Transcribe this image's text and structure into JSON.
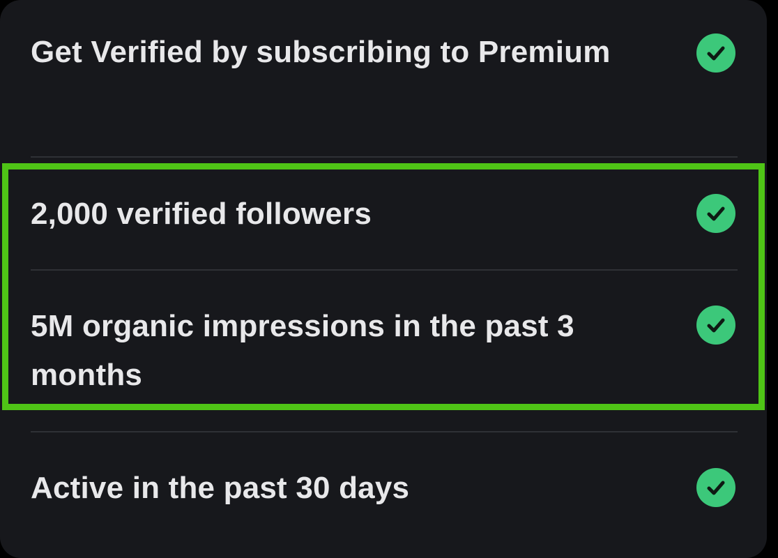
{
  "requirements": [
    {
      "label": "Get Verified by subscribing to Premium",
      "status_icon": "check-circle-icon",
      "met": true
    },
    {
      "label": "2,000 verified followers",
      "status_icon": "check-circle-icon",
      "met": true
    },
    {
      "label": "5M organic impressions in the past 3 months",
      "status_icon": "check-circle-icon",
      "met": true
    },
    {
      "label": "Active in the past 30 days",
      "status_icon": "check-circle-icon",
      "met": true
    }
  ],
  "colors": {
    "background": "#17181c",
    "text": "#e8e8ea",
    "check": "#3cc87a",
    "divider": "#2f3136",
    "highlight": "#4fc416"
  }
}
